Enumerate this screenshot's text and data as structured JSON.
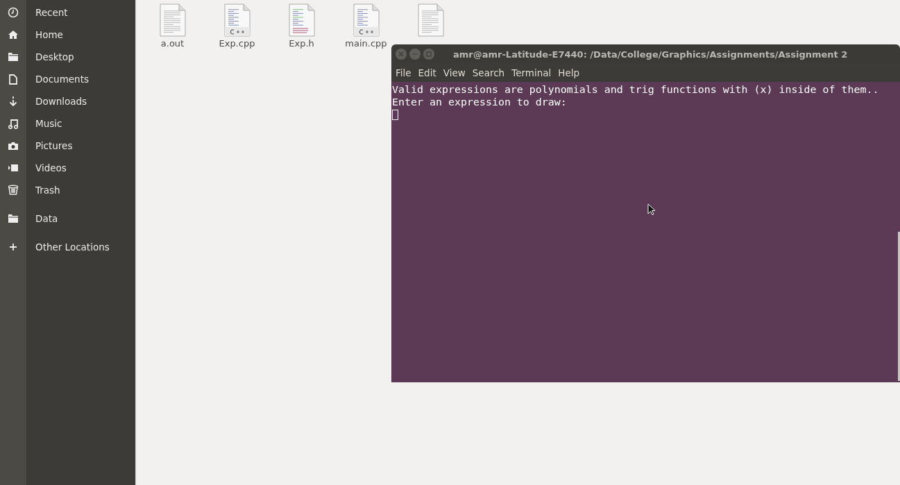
{
  "sidebar": {
    "groups": [
      {
        "items": [
          {
            "label": "Recent"
          },
          {
            "label": "Home"
          },
          {
            "label": "Desktop"
          },
          {
            "label": "Documents"
          },
          {
            "label": "Downloads"
          },
          {
            "label": "Music"
          },
          {
            "label": "Pictures"
          },
          {
            "label": "Videos"
          },
          {
            "label": "Trash"
          }
        ]
      },
      {
        "items": [
          {
            "label": "Data"
          }
        ]
      },
      {
        "items": [
          {
            "label": "Other Locations"
          }
        ]
      }
    ]
  },
  "files": [
    {
      "name": "a.out",
      "kind": "text"
    },
    {
      "name": "Exp.cpp",
      "kind": "cpp"
    },
    {
      "name": "Exp.h",
      "kind": "header"
    },
    {
      "name": "main.cpp",
      "kind": "cpp"
    },
    {
      "kind": "text"
    }
  ],
  "terminal": {
    "title": "amr@amr-Latitude-E7440: /Data/College/Graphics/Assignments/Assignment 2",
    "menu": [
      "File",
      "Edit",
      "View",
      "Search",
      "Terminal",
      "Help"
    ],
    "lines": [
      "Valid expressions are polynomials and trig functions with (x) inside of them..",
      "Enter an expression to draw:"
    ]
  }
}
